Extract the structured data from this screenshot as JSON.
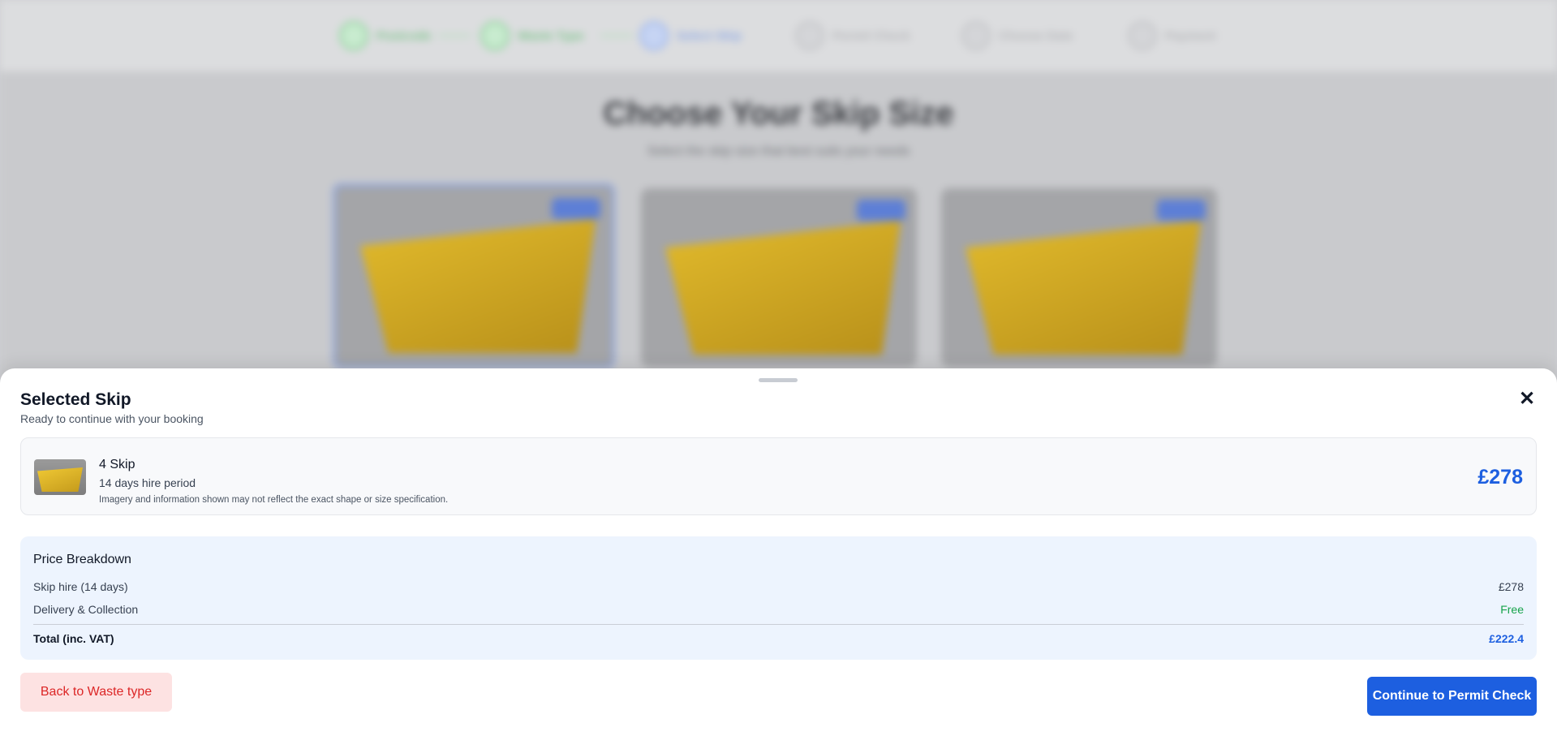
{
  "background": {
    "steps": [
      {
        "label": "Postcode"
      },
      {
        "label": "Waste Type"
      },
      {
        "label": "Select Skip"
      },
      {
        "label": "Permit Check"
      },
      {
        "label": "Choose Date"
      },
      {
        "label": "Payment"
      }
    ],
    "title": "Choose Your Skip Size",
    "subtitle": "Select the skip size that best suits your needs"
  },
  "sheet": {
    "title": "Selected Skip",
    "subtitle": "Ready to continue with your booking",
    "close_icon": "close-icon",
    "item": {
      "name": "4 Skip",
      "period": "14 days hire period",
      "note": "Imagery and information shown may not reflect the exact shape or size specification.",
      "price": "£278"
    },
    "breakdown": {
      "title": "Price Breakdown",
      "rows": [
        {
          "label": "Skip hire (14 days)",
          "value": "£278"
        },
        {
          "label": "Delivery & Collection",
          "value": "Free"
        }
      ],
      "total_label": "Total (inc. VAT)",
      "total_value": "£222.4"
    },
    "back_label": "Back to Waste type",
    "continue_label": "Continue to Permit Check"
  },
  "colors": {
    "accent": "#1d5fe0",
    "danger": "#dc2626",
    "success": "#16a34a"
  }
}
